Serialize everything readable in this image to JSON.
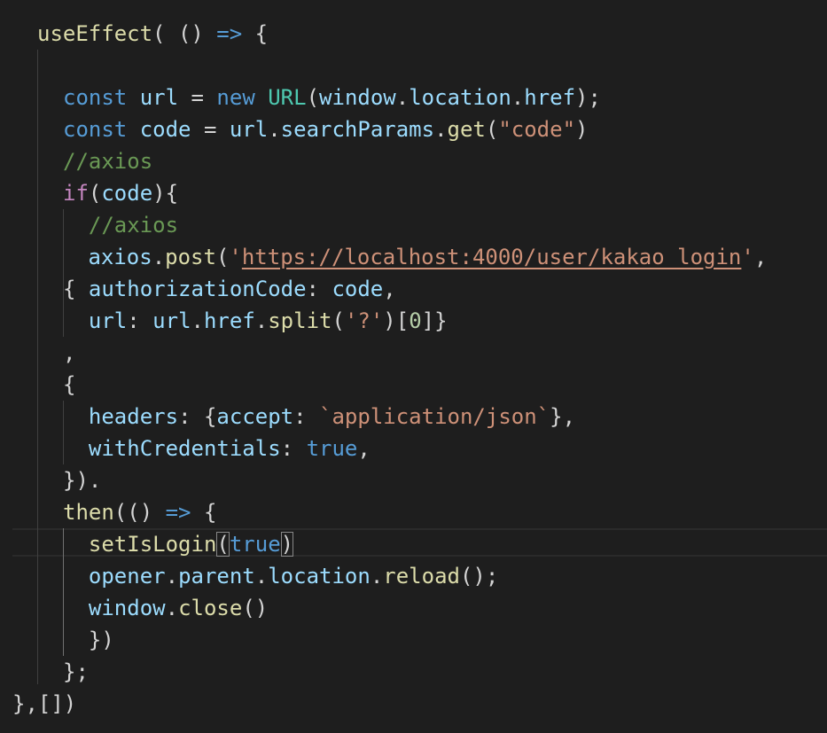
{
  "colors": {
    "background": "#1e1e1e",
    "keyword": "#569cd6",
    "control": "#c586c0",
    "function": "#dcdcaa",
    "variable": "#9cdcfe",
    "class": "#4ec9b0",
    "string": "#ce9178",
    "number": "#b5cea8",
    "comment": "#6a9955",
    "punctuation": "#d4d4d4"
  },
  "code_lines": [
    [
      [
        "fn",
        "useEffect"
      ],
      [
        "pun",
        "( () "
      ],
      [
        "kw",
        "=>"
      ],
      [
        "pun",
        " {"
      ]
    ],
    [],
    [
      [
        "kw",
        "const"
      ],
      [
        "pun",
        " "
      ],
      [
        "var",
        "url"
      ],
      [
        "pun",
        " = "
      ],
      [
        "kw",
        "new"
      ],
      [
        "pun",
        " "
      ],
      [
        "cls",
        "URL"
      ],
      [
        "pun",
        "("
      ],
      [
        "var",
        "window"
      ],
      [
        "pun",
        "."
      ],
      [
        "var",
        "location"
      ],
      [
        "pun",
        "."
      ],
      [
        "var",
        "href"
      ],
      [
        "pun",
        ");"
      ]
    ],
    [
      [
        "kw",
        "const"
      ],
      [
        "pun",
        " "
      ],
      [
        "var",
        "code"
      ],
      [
        "pun",
        " = "
      ],
      [
        "var",
        "url"
      ],
      [
        "pun",
        "."
      ],
      [
        "var",
        "searchParams"
      ],
      [
        "pun",
        "."
      ],
      [
        "fn",
        "get"
      ],
      [
        "pun",
        "("
      ],
      [
        "str",
        "\"code\""
      ],
      [
        "pun",
        ")"
      ]
    ],
    [
      [
        "cmt",
        "//axios"
      ]
    ],
    [
      [
        "ctl",
        "if"
      ],
      [
        "pun",
        "("
      ],
      [
        "var",
        "code"
      ],
      [
        "pun",
        "){"
      ]
    ],
    [
      [
        "cmt",
        "  //axios"
      ]
    ],
    [
      [
        "pun",
        " "
      ],
      [
        "var",
        "axios"
      ],
      [
        "pun",
        "."
      ],
      [
        "fn",
        "post"
      ],
      [
        "pun",
        "("
      ],
      [
        "str",
        "'"
      ],
      [
        "str-u",
        "https://localhost:4000/user/kakao_login"
      ],
      [
        "str",
        "'"
      ],
      [
        "pun",
        ","
      ]
    ],
    [
      [
        "pun",
        "{ "
      ],
      [
        "var",
        "authorizationCode"
      ],
      [
        "pun",
        ": "
      ],
      [
        "var",
        "code"
      ],
      [
        "pun",
        ","
      ]
    ],
    [
      [
        "pun",
        "  "
      ],
      [
        "var",
        "url"
      ],
      [
        "pun",
        ": "
      ],
      [
        "var",
        "url"
      ],
      [
        "pun",
        "."
      ],
      [
        "var",
        "href"
      ],
      [
        "pun",
        "."
      ],
      [
        "fn",
        "split"
      ],
      [
        "pun",
        "("
      ],
      [
        "str",
        "'?'"
      ],
      [
        "pun",
        ")["
      ],
      [
        "num",
        "0"
      ],
      [
        "pun",
        "]}"
      ]
    ],
    [
      [
        "pun",
        ","
      ]
    ],
    [
      [
        "pun",
        "{"
      ]
    ],
    [
      [
        "pun",
        "  "
      ],
      [
        "var",
        "headers"
      ],
      [
        "pun",
        ": {"
      ],
      [
        "var",
        "accept"
      ],
      [
        "pun",
        ": "
      ],
      [
        "str",
        "`application/json`"
      ],
      [
        "pun",
        "},"
      ]
    ],
    [
      [
        "pun",
        "  "
      ],
      [
        "var",
        "withCredentials"
      ],
      [
        "pun",
        ": "
      ],
      [
        "kw",
        "true"
      ],
      [
        "pun",
        ","
      ]
    ],
    [
      [
        "pun",
        "})."
      ]
    ],
    [
      [
        "fn",
        "then"
      ],
      [
        "pun",
        "(() "
      ],
      [
        "kw",
        "=>"
      ],
      [
        "pun",
        " {"
      ]
    ],
    [
      [
        "pun",
        "  "
      ],
      [
        "fn",
        "setIsLogin"
      ],
      [
        "brk",
        "("
      ],
      [
        "kw",
        "true"
      ],
      [
        "brk",
        ")"
      ]
    ],
    [
      [
        "pun",
        "  "
      ],
      [
        "var",
        "opener"
      ],
      [
        "pun",
        "."
      ],
      [
        "var",
        "parent"
      ],
      [
        "pun",
        "."
      ],
      [
        "var",
        "location"
      ],
      [
        "pun",
        "."
      ],
      [
        "fn",
        "reload"
      ],
      [
        "pun",
        "();"
      ]
    ],
    [
      [
        "pun",
        "  "
      ],
      [
        "var",
        "window"
      ],
      [
        "pun",
        "."
      ],
      [
        "fn",
        "close"
      ],
      [
        "pun",
        "()"
      ]
    ],
    [
      [
        "pun",
        "  })"
      ]
    ],
    [
      [
        "pun",
        "};"
      ]
    ],
    [
      [
        "pun",
        "},[])"
      ]
    ]
  ]
}
